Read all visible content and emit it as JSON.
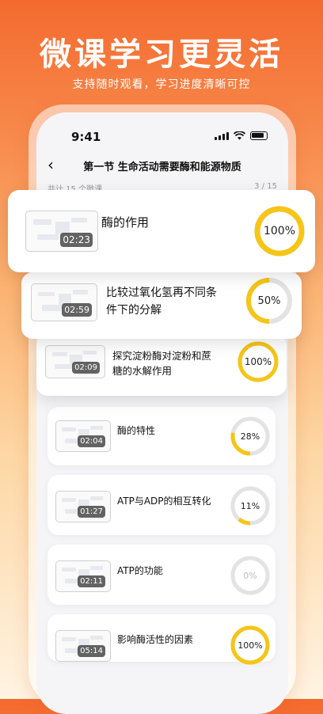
{
  "hero": {
    "title": "微课学习更灵活",
    "subtitle": "支持随时观看，学习进度清晰可控"
  },
  "status": {
    "time": "9:41"
  },
  "nav": {
    "back_icon": "chevron-left-icon",
    "title": "第一节 生命活动需要酶和能源物质"
  },
  "count": {
    "total": "共计 15 个微课",
    "position": "3 / 15"
  },
  "accent": "#f5c518",
  "lessons": [
    {
      "title": "酶的作用",
      "duration": "02:23",
      "progress": 100,
      "progress_label": "100%"
    },
    {
      "title": "比较过氧化氢再不同条件下的分解",
      "duration": "02:59",
      "progress": 50,
      "progress_label": "50%"
    },
    {
      "title": "探究淀粉酶对淀粉和蔗糖的水解作用",
      "duration": "02:09",
      "progress": 100,
      "progress_label": "100%"
    },
    {
      "title": "酶的特性",
      "duration": "02:04",
      "progress": 28,
      "progress_label": "28%"
    },
    {
      "title": "ATP与ADP的相互转化",
      "duration": "01:27",
      "progress": 11,
      "progress_label": "11%"
    },
    {
      "title": "ATP的功能",
      "duration": "02:11",
      "progress": 0,
      "progress_label": "0%"
    },
    {
      "title": "影响酶活性的因素",
      "duration": "05:14",
      "progress": 100,
      "progress_label": "100%"
    }
  ]
}
